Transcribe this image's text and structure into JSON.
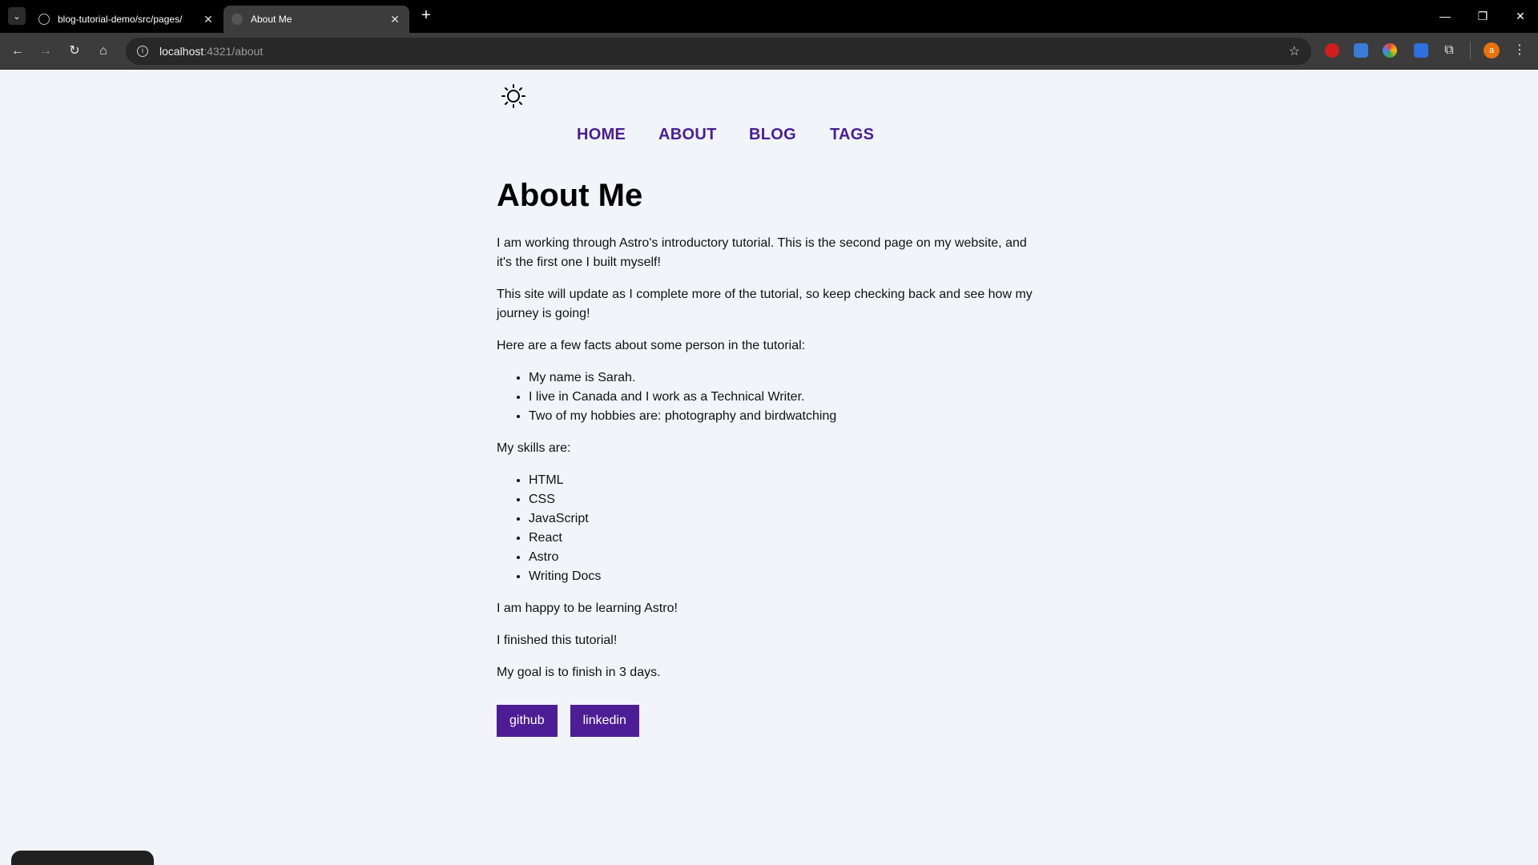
{
  "browser": {
    "tabs": [
      {
        "title": "blog-tutorial-demo/src/pages/",
        "active": false
      },
      {
        "title": "About Me",
        "active": true
      }
    ],
    "address": {
      "host": "localhost",
      "path": ":4321/about"
    }
  },
  "nav": {
    "links": [
      "HOME",
      "ABOUT",
      "BLOG",
      "TAGS"
    ]
  },
  "page": {
    "title": "About Me",
    "intro_1": "I am working through Astro's introductory tutorial. This is the second page on my website, and it's the first one I built myself!",
    "intro_2": "This site will update as I complete more of the tutorial, so keep checking back and see how my journey is going!",
    "facts_heading": "Here are a few facts about some person in the tutorial:",
    "facts": [
      "My name is Sarah.",
      "I live in Canada and I work as a Technical Writer.",
      "Two of my hobbies are: photography and birdwatching"
    ],
    "skills_heading": "My skills are:",
    "skills": [
      "HTML",
      "CSS",
      "JavaScript",
      "React",
      "Astro",
      "Writing Docs"
    ],
    "happy": "I am happy to be learning Astro!",
    "finished": "I finished this tutorial!",
    "goal": "My goal is to finish in 3 days."
  },
  "social": [
    "github",
    "linkedin"
  ],
  "colors": {
    "accent": "#4a1d96",
    "button_bg": "#4c1d95",
    "page_bg": "#f1f5f9"
  }
}
